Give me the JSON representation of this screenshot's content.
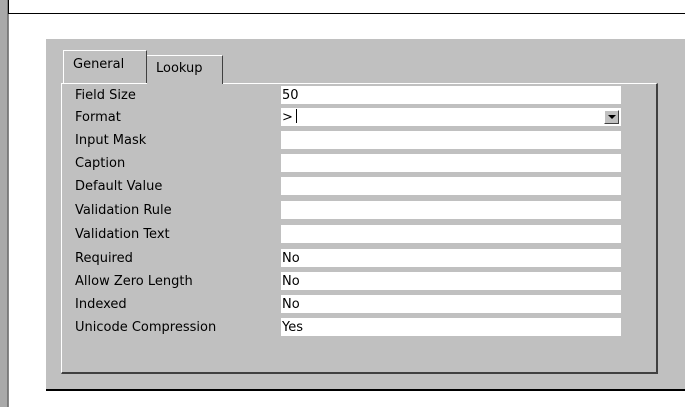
{
  "tabs": [
    {
      "label": "General",
      "active": true
    },
    {
      "label": "Lookup",
      "active": false
    }
  ],
  "fields": [
    {
      "label": "Field Size",
      "value": "50"
    },
    {
      "label": "Format",
      "value": ">",
      "dropdown": true
    },
    {
      "label": "Input Mask",
      "value": ""
    },
    {
      "label": "Caption",
      "value": ""
    },
    {
      "label": "Default Value",
      "value": ""
    },
    {
      "label": "Validation Rule",
      "value": ""
    },
    {
      "label": "Validation Text",
      "value": ""
    },
    {
      "label": "Required",
      "value": "No"
    },
    {
      "label": "Allow Zero Length",
      "value": "No"
    },
    {
      "label": "Indexed",
      "value": "No"
    },
    {
      "label": "Unicode Compression",
      "value": "Yes"
    }
  ],
  "icons": {
    "dropdown": "chevron-down-icon"
  }
}
